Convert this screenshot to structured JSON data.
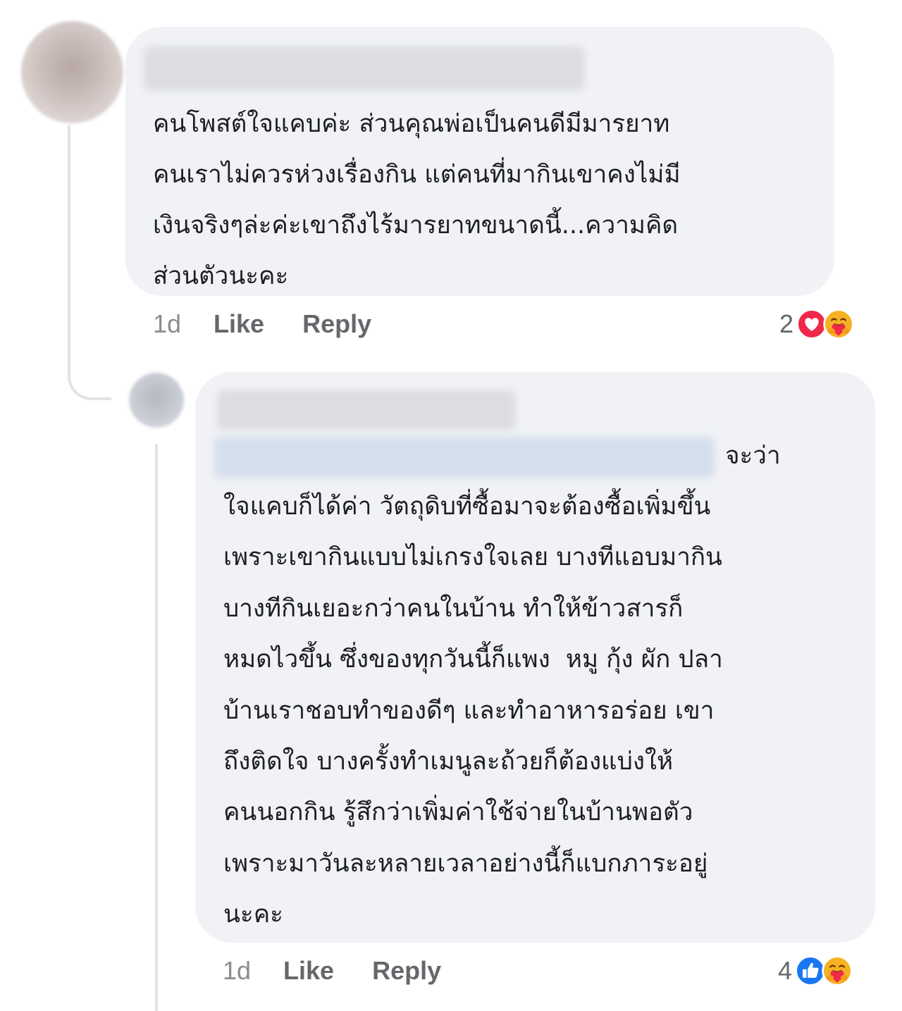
{
  "comments": [
    {
      "text": "คนโพสต์ใจแคบค่ะ ส่วนคุณพ่อเป็นคนดีมีมารยาท\nคนเราไม่ควรห่วงเรื่องกิน แต่คนที่มากินเขาคงไม่มี\nเงินจริงๆล่ะค่ะเขาถึงไร้มารยาทขนาดนี้...ความคิด\nส่วนตัวนะคะ",
      "time": "1d",
      "like_label": "Like",
      "reply_label": "Reply",
      "reaction_count": "2",
      "reaction_icons": [
        "love-icon",
        "care-icon"
      ]
    },
    {
      "text": "จะว่า\nใจแคบก็ได้ค่า วัตถุดิบที่ซื้อมาจะต้องซื้อเพิ่มขึ้น\nเพราะเขากินแบบไม่เกรงใจเลย บางทีแอบมากิน\nบางทีกินเยอะกว่าคนในบ้าน ทำให้ข้าวสารก็\nหมดไวขึ้น ซึ่งของทุกวันนี้ก็แพง  หมู กุ้ง ผัก ปลา\nบ้านเราชอบทำของดีๆ และทำอาหารอร่อย เขา\nถึงติดใจ บางครั้งทำเมนูละถ้วยก็ต้องแบ่งให้\nคนนอกกิน รู้สึกว่าเพิ่มค่าใช้จ่ายในบ้านพอตัว\nเพราะมาวันละหลายเวลาอย่างนี้ก็แบกภาระอยู่\nนะคะ",
      "time": "1d",
      "like_label": "Like",
      "reply_label": "Reply",
      "reaction_count": "4",
      "reaction_icons": [
        "like-icon",
        "care-icon"
      ]
    }
  ],
  "colors": {
    "bubble": "#f0f2f5",
    "text": "#1c1e21",
    "meta": "#65676b",
    "love": "#f0284a",
    "like": "#1877f2",
    "care": "#f7b125"
  }
}
